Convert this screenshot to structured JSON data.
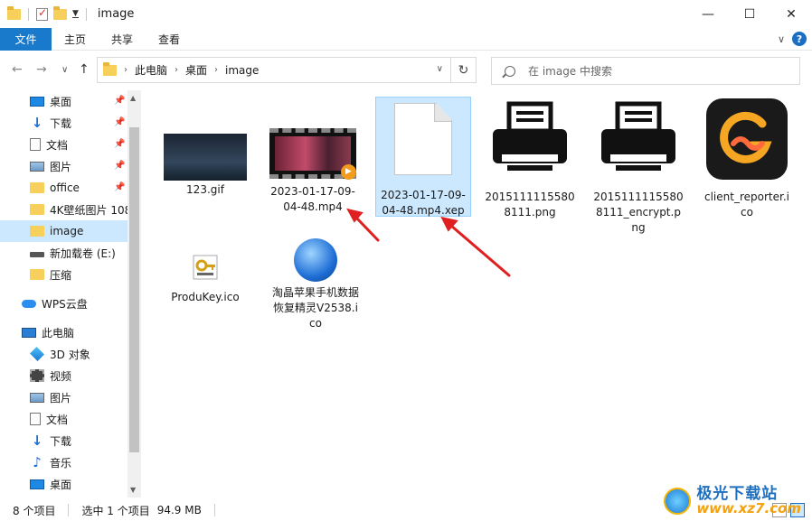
{
  "window": {
    "title": "image",
    "controls": {
      "minimize": "—",
      "maximize": "☐",
      "close": "✕"
    }
  },
  "ribbon": {
    "tabs": [
      "文件",
      "主页",
      "共享",
      "查看"
    ],
    "expand_icon": "chevron-down-icon",
    "help_label": "?"
  },
  "nav": {
    "back": "←",
    "forward": "→",
    "recent": "∨",
    "up": "↑",
    "breadcrumb": [
      "此电脑",
      "桌面",
      "image"
    ],
    "refresh": "↻",
    "search_placeholder": "在 image 中搜索"
  },
  "sidebar": {
    "items": [
      {
        "label": "桌面",
        "icon": "desktop-icon",
        "pinned": true
      },
      {
        "label": "下载",
        "icon": "download-icon",
        "pinned": true
      },
      {
        "label": "文档",
        "icon": "document-icon",
        "pinned": true
      },
      {
        "label": "图片",
        "icon": "picture-icon",
        "pinned": true
      },
      {
        "label": "office",
        "icon": "folder-icon",
        "pinned": true
      },
      {
        "label": "4K壁纸图片 108",
        "icon": "folder-icon",
        "pinned": false
      },
      {
        "label": "image",
        "icon": "folder-icon",
        "pinned": false,
        "selected": true
      },
      {
        "label": "新加载卷 (E:)",
        "icon": "drive-icon",
        "pinned": false
      },
      {
        "label": "压缩",
        "icon": "folder-icon",
        "pinned": false
      },
      {
        "label": "WPS云盘",
        "icon": "cloud-icon",
        "pinned": false
      },
      {
        "label": "此电脑",
        "icon": "computer-icon",
        "pinned": false
      },
      {
        "label": "3D 对象",
        "icon": "3d-objects-icon",
        "pinned": false
      },
      {
        "label": "视频",
        "icon": "video-icon",
        "pinned": false
      },
      {
        "label": "图片",
        "icon": "picture-icon",
        "pinned": false
      },
      {
        "label": "文档",
        "icon": "document-icon",
        "pinned": false
      },
      {
        "label": "下载",
        "icon": "download-icon",
        "pinned": false
      },
      {
        "label": "音乐",
        "icon": "music-icon",
        "pinned": false
      },
      {
        "label": "桌面",
        "icon": "desktop-icon",
        "pinned": false
      }
    ]
  },
  "files": [
    {
      "name": "123.gif",
      "thumb": "gif-thumbnail"
    },
    {
      "name": "2023-01-17-09-04-48.mp4",
      "thumb": "video-thumbnail"
    },
    {
      "name": "2023-01-17-09-04-48.mp4.xep",
      "thumb": "blank-file-icon",
      "selected": true
    },
    {
      "name": "20151111155808111.png",
      "thumb": "printer-icon"
    },
    {
      "name": "20151111155808111_encrypt.png",
      "thumb": "printer-icon"
    },
    {
      "name": "client_reporter.ico",
      "thumb": "app-g-icon"
    },
    {
      "name": "ProduKey.ico",
      "thumb": "key-icon"
    },
    {
      "name": "淘晶苹果手机数据恢复精灵V2538.ico",
      "thumb": "disc-icon"
    }
  ],
  "status": {
    "item_count": "8 个项目",
    "selection": "选中 1 个项目",
    "size": "94.9 MB"
  },
  "watermark": {
    "name": "极光下载站",
    "url": "www.xz7.com"
  },
  "colors": {
    "accent": "#1979ca",
    "selection": "#cce8ff",
    "annotation_arrow": "#e02020"
  }
}
